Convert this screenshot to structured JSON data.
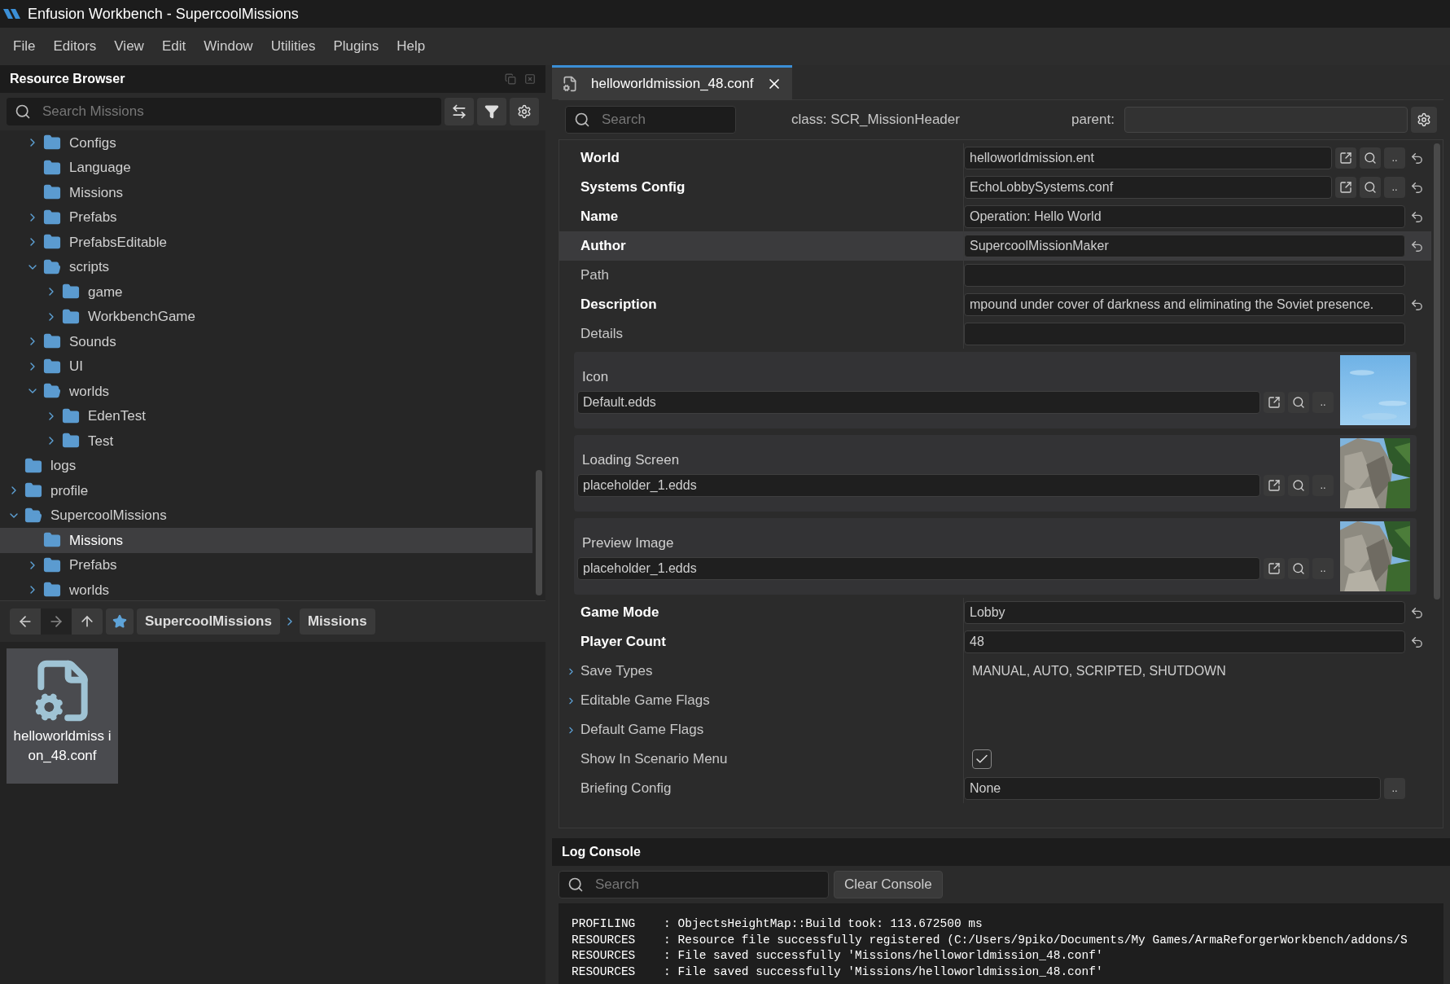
{
  "window": {
    "title": "Enfusion Workbench - SupercoolMissions"
  },
  "menu": [
    "File",
    "Editors",
    "View",
    "Edit",
    "Window",
    "Utilities",
    "Plugins",
    "Help"
  ],
  "resource_browser": {
    "title": "Resource Browser",
    "search": {
      "placeholder": "Search Missions"
    },
    "tree": {
      "continued": [
        {
          "label": "Configs",
          "expandable": true,
          "expanded": false,
          "selected": false
        },
        {
          "label": "Language",
          "expandable": false,
          "expanded": false,
          "selected": false
        },
        {
          "label": "Missions",
          "expandable": false,
          "expanded": false,
          "selected": false
        },
        {
          "label": "Prefabs",
          "expandable": true,
          "expanded": false,
          "selected": false
        },
        {
          "label": "PrefabsEditable",
          "expandable": true,
          "expanded": false,
          "selected": false
        },
        {
          "label": "scripts",
          "expandable": true,
          "expanded": true,
          "selected": false,
          "children": [
            {
              "label": "game",
              "expandable": true,
              "expanded": false,
              "selected": false
            },
            {
              "label": "WorkbenchGame",
              "expandable": true,
              "expanded": false,
              "selected": false
            }
          ]
        },
        {
          "label": "Sounds",
          "expandable": true,
          "expanded": false,
          "selected": false
        },
        {
          "label": "UI",
          "expandable": true,
          "expanded": false,
          "selected": false
        },
        {
          "label": "worlds",
          "expandable": true,
          "expanded": true,
          "selected": false,
          "children": [
            {
              "label": "EdenTest",
              "expandable": true,
              "expanded": false,
              "selected": false
            },
            {
              "label": "Test",
              "expandable": true,
              "expanded": false,
              "selected": false
            }
          ]
        }
      ],
      "items": [
        {
          "label": "logs",
          "expandable": false,
          "expanded": false,
          "selected": false
        },
        {
          "label": "profile",
          "expandable": true,
          "expanded": false,
          "selected": false
        },
        {
          "label": "SupercoolMissions",
          "expandable": true,
          "expanded": true,
          "selected": false,
          "children": [
            {
              "label": "Missions",
              "expandable": false,
              "expanded": false,
              "selected": true
            },
            {
              "label": "Prefabs",
              "expandable": true,
              "expanded": false,
              "selected": false
            },
            {
              "label": "worlds",
              "expandable": true,
              "expanded": false,
              "selected": false
            }
          ]
        }
      ]
    },
    "breadcrumb": [
      "SupercoolMissions",
      "Missions"
    ],
    "files": [
      {
        "name": "helloworldmiss ion_48.conf",
        "selected": true
      }
    ]
  },
  "editor": {
    "tabs": [
      {
        "label": "helloworldmission_48.conf",
        "selected": true
      }
    ],
    "search": {
      "placeholder": "Search"
    },
    "class": "class: SCR_MissionHeader",
    "parent_label": "parent:",
    "properties": [
      {
        "kind": "field",
        "label": "World",
        "bold": true,
        "value": "helloworldmission.ent",
        "buttons": [
          {
            "kind": "open"
          },
          {
            "kind": "search"
          },
          {
            "kind": "more",
            "label": ".."
          }
        ],
        "reset": true,
        "selected": false
      },
      {
        "kind": "field",
        "label": "Systems Config",
        "bold": true,
        "value": "EchoLobbySystems.conf",
        "buttons": [
          {
            "kind": "open"
          },
          {
            "kind": "search"
          },
          {
            "kind": "more",
            "label": ".."
          }
        ],
        "reset": true,
        "selected": false
      },
      {
        "kind": "field",
        "label": "Name",
        "bold": true,
        "value": "Operation: Hello World",
        "reset": true,
        "selected": false
      },
      {
        "kind": "field",
        "label": "Author",
        "bold": true,
        "value": "SupercoolMissionMaker",
        "reset": true,
        "selected": true
      },
      {
        "kind": "field",
        "label": "Path",
        "bold": false,
        "reset": false,
        "selected": false
      },
      {
        "kind": "field",
        "label": "Description",
        "bold": true,
        "value": "mpound under cover of darkness and eliminating the Soviet presence.",
        "reset": true,
        "selected": false
      },
      {
        "kind": "field",
        "label": "Details",
        "bold": false,
        "reset": false,
        "selected": false
      },
      {
        "kind": "resource",
        "label": "Icon",
        "value": "Default.edds",
        "preview": {
          "kind": "sky"
        },
        "buttons": [
          {
            "kind": "open"
          },
          {
            "kind": "search"
          },
          {
            "kind": "more",
            "label": ".."
          }
        ]
      },
      {
        "kind": "resource",
        "label": "Loading Screen",
        "value": "placeholder_1.edds",
        "preview": {
          "kind": "rocks"
        },
        "buttons": [
          {
            "kind": "open"
          },
          {
            "kind": "search"
          },
          {
            "kind": "more",
            "label": ".."
          }
        ]
      },
      {
        "kind": "resource",
        "label": "Preview Image",
        "value": "placeholder_1.edds",
        "preview": {
          "kind": "rocks"
        },
        "buttons": [
          {
            "kind": "open"
          },
          {
            "kind": "search"
          },
          {
            "kind": "more",
            "label": ".."
          }
        ]
      },
      {
        "kind": "field",
        "label": "Game Mode",
        "bold": true,
        "value": "Lobby",
        "reset": true,
        "selected": false
      },
      {
        "kind": "field",
        "label": "Player Count",
        "bold": true,
        "value": "48",
        "reset": true,
        "selected": false
      },
      {
        "kind": "expandable",
        "label": "Save Types",
        "value": "MANUAL, AUTO, SCRIPTED, SHUTDOWN",
        "expanded": false
      },
      {
        "kind": "expandable",
        "label": "Editable Game Flags",
        "expanded": false
      },
      {
        "kind": "expandable",
        "label": "Default Game Flags",
        "expanded": false
      },
      {
        "kind": "checkbox",
        "label": "Show In Scenario Menu",
        "checked": true
      },
      {
        "kind": "field",
        "label": "Briefing Config",
        "bold": false,
        "value": "None",
        "buttons": [
          {
            "kind": "more",
            "label": ".."
          }
        ],
        "reset": false,
        "selected": false
      }
    ]
  },
  "log_console": {
    "title": "Log Console",
    "search": {
      "placeholder": "Search"
    },
    "clear_button": "Clear Console",
    "lines": [
      "PROFILING    : ObjectsHeightMap::Build took: 113.672500 ms",
      "RESOURCES    : Resource file successfully registered (C:/Users/9piko/Documents/My Games/ArmaReforgerWorkbench/addons/S",
      "RESOURCES    : File saved successfully 'Missions/helloworldmission_48.conf'",
      "RESOURCES    : File saved successfully 'Missions/helloworldmission_48.conf'"
    ]
  }
}
